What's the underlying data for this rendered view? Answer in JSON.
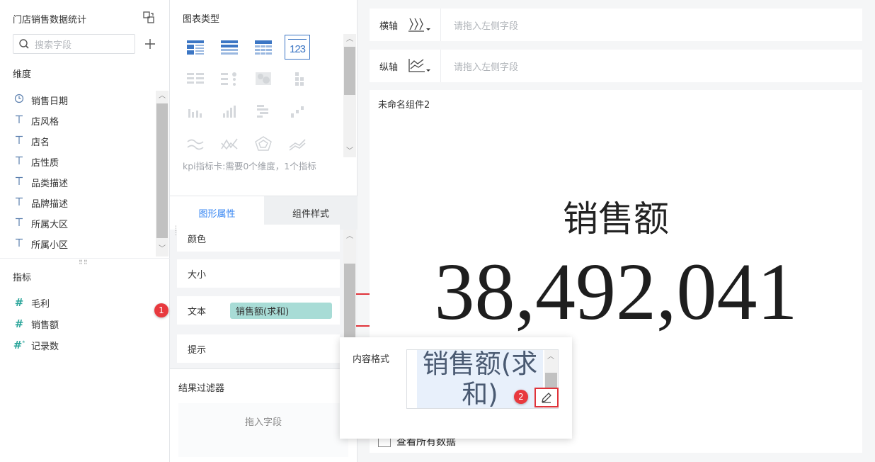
{
  "left": {
    "title": "门店销售数据统计",
    "search_placeholder": "搜索字段",
    "dimension_label": "维度",
    "dimensions": [
      {
        "icon": "clock-icon",
        "label": "销售日期"
      },
      {
        "icon": "text-icon",
        "label": "店风格"
      },
      {
        "icon": "text-icon",
        "label": "店名"
      },
      {
        "icon": "text-icon",
        "label": "店性质"
      },
      {
        "icon": "text-icon",
        "label": "品类描述"
      },
      {
        "icon": "text-icon",
        "label": "品牌描述"
      },
      {
        "icon": "text-icon",
        "label": "所属大区"
      },
      {
        "icon": "text-icon",
        "label": "所属小区"
      }
    ],
    "measure_label": "指标",
    "measures": [
      {
        "icon": "hash-icon",
        "label": "毛利"
      },
      {
        "icon": "hash-icon",
        "label": "销售额"
      },
      {
        "icon": "hash-icon",
        "label": "记录数"
      }
    ]
  },
  "mid": {
    "chart_type_label": "图表类型",
    "kpi_text": "123",
    "chart_hint": "kpi指标卡:需要0个维度，1个指标",
    "tabs": [
      "图形属性",
      "组件样式"
    ],
    "props": {
      "color": "颜色",
      "size": "大小",
      "text": "文本",
      "text_pill": "销售额(求和)",
      "tooltip": "提示"
    },
    "filter_label": "结果过滤器",
    "filter_drop": "拖入字段"
  },
  "axes": {
    "x_label": "横轴",
    "y_label": "纵轴",
    "placeholder": "请拖入左侧字段"
  },
  "canvas": {
    "title": "未命名组件2",
    "kpi_label": "销售额",
    "kpi_value": "38,492,041",
    "view_all": "查看所有数据"
  },
  "popup": {
    "label": "内容格式",
    "content": "销售额(求和)"
  },
  "markers": [
    "1",
    "2"
  ],
  "colors": {
    "accent": "#3685f2",
    "pill": "#a8dcd6",
    "marker": "#e8393e",
    "highlight": "#e0333a"
  }
}
